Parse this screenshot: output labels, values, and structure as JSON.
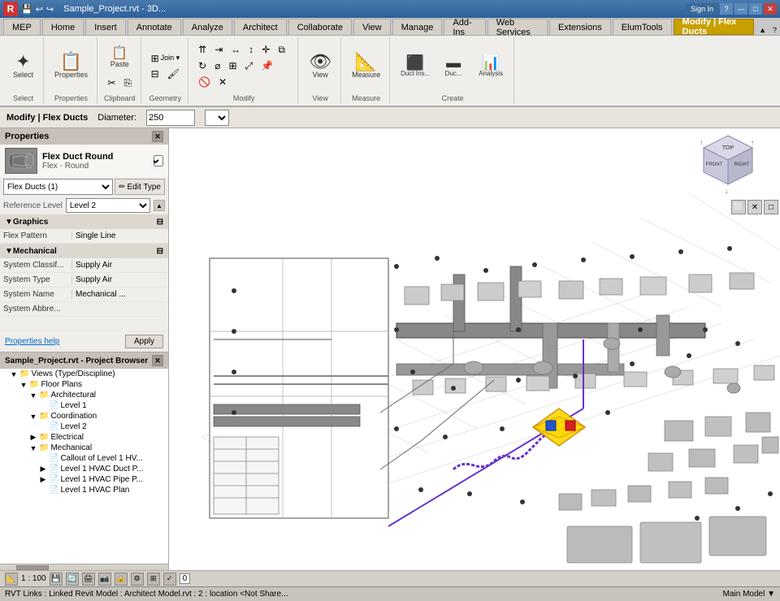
{
  "titlebar": {
    "title": "Sample_Project.rvt - 3D...",
    "app_icon": "R",
    "controls": [
      "—",
      "□",
      "✕"
    ]
  },
  "ribbon": {
    "tabs": [
      {
        "label": "MEP",
        "id": "mep"
      },
      {
        "label": "Home",
        "id": "home"
      },
      {
        "label": "Insert",
        "id": "insert"
      },
      {
        "label": "Annotate",
        "id": "annotate"
      },
      {
        "label": "Analyze",
        "id": "analyze"
      },
      {
        "label": "Architect",
        "id": "architect"
      },
      {
        "label": "Collaborate",
        "id": "collaborate"
      },
      {
        "label": "View",
        "id": "view"
      },
      {
        "label": "Manage",
        "id": "manage"
      },
      {
        "label": "Add-Ins",
        "id": "addins"
      },
      {
        "label": "Web Services",
        "id": "webservices"
      },
      {
        "label": "Extensions",
        "id": "extensions"
      },
      {
        "label": "ElumTools",
        "id": "elumtools"
      },
      {
        "label": "Modify | Flex Ducts",
        "id": "modify_flexducts",
        "active": true,
        "highlight": true
      }
    ],
    "groups": {
      "select": {
        "label": "Select",
        "icon": "⊹"
      },
      "properties": {
        "label": "Properties",
        "icon": "☰"
      },
      "clipboard": {
        "label": "Clipboard",
        "icon": "📋"
      },
      "geometry": {
        "label": "Geometry",
        "icon": "◈"
      },
      "modify": {
        "label": "Modify",
        "icon": "✂"
      },
      "view": {
        "label": "View",
        "icon": "👁"
      },
      "measure": {
        "label": "Measure",
        "icon": "📏"
      },
      "create": {
        "label": "Create",
        "icon": "⊕"
      }
    }
  },
  "context_bar": {
    "label": "Modify | Flex Ducts",
    "diameter_label": "Diameter:",
    "diameter_value": "250",
    "diameter_unit": ""
  },
  "properties": {
    "panel_title": "Properties",
    "type_icon": "🌀",
    "type_name": "Flex Duct Round",
    "type_subname": "Flex - Round",
    "dropdown_value": "Flex Ducts (1)",
    "edit_type_label": "Edit Type",
    "ref_level_label": "Reference Level",
    "ref_level_value": "Level 2",
    "sections": {
      "graphics": {
        "label": "Graphics",
        "rows": [
          {
            "label": "Flex Pattern",
            "value": "Single Line"
          }
        ]
      },
      "mechanical": {
        "label": "Mechanical",
        "rows": [
          {
            "label": "System Classif...",
            "value": "Supply Air"
          },
          {
            "label": "System Type",
            "value": "Supply Air"
          },
          {
            "label": "System Name",
            "value": "Mechanical ..."
          },
          {
            "label": "System Abbre...",
            "value": ""
          }
        ]
      }
    },
    "help_link": "Properties help",
    "apply_label": "Apply"
  },
  "project_browser": {
    "title": "Sample_Project.rvt - Project Browser",
    "tree": [
      {
        "level": 0,
        "label": "Views (Type/Discipline)",
        "expand": "▼",
        "icon": "📁"
      },
      {
        "level": 1,
        "label": "Floor Plans",
        "expand": "▼",
        "icon": "📁"
      },
      {
        "level": 2,
        "label": "Architectural",
        "expand": "▼",
        "icon": "📁"
      },
      {
        "level": 3,
        "label": "Level 1",
        "expand": " ",
        "icon": "📄"
      },
      {
        "level": 2,
        "label": "Coordination",
        "expand": "▼",
        "icon": "📁"
      },
      {
        "level": 3,
        "label": "Level 2",
        "expand": " ",
        "icon": "📄"
      },
      {
        "level": 2,
        "label": "Electrical",
        "expand": "▶",
        "icon": "📁"
      },
      {
        "level": 2,
        "label": "Mechanical",
        "expand": "▼",
        "icon": "📁"
      },
      {
        "level": 3,
        "label": "Callout of Level 1 HV...",
        "expand": " ",
        "icon": "📄"
      },
      {
        "level": 3,
        "label": "Level 1 HVAC Duct P...",
        "expand": " ",
        "icon": "📄"
      },
      {
        "level": 3,
        "label": "Level 1 HVAC Pipe P...",
        "expand": " ",
        "icon": "📄"
      },
      {
        "level": 3,
        "label": "Level 1 HVAC Plan",
        "expand": " ",
        "icon": "📄"
      }
    ]
  },
  "statusbar": {
    "scale": "1 : 100",
    "message": "RVT Links : Linked Revit Model : Architect Model.rvt : 2 : location <Not Share...",
    "model": "Main Model",
    "workset_icon": "⚙"
  },
  "view": {
    "nav_faces": [
      "TOP",
      "FRONT",
      "RIGHT"
    ]
  }
}
